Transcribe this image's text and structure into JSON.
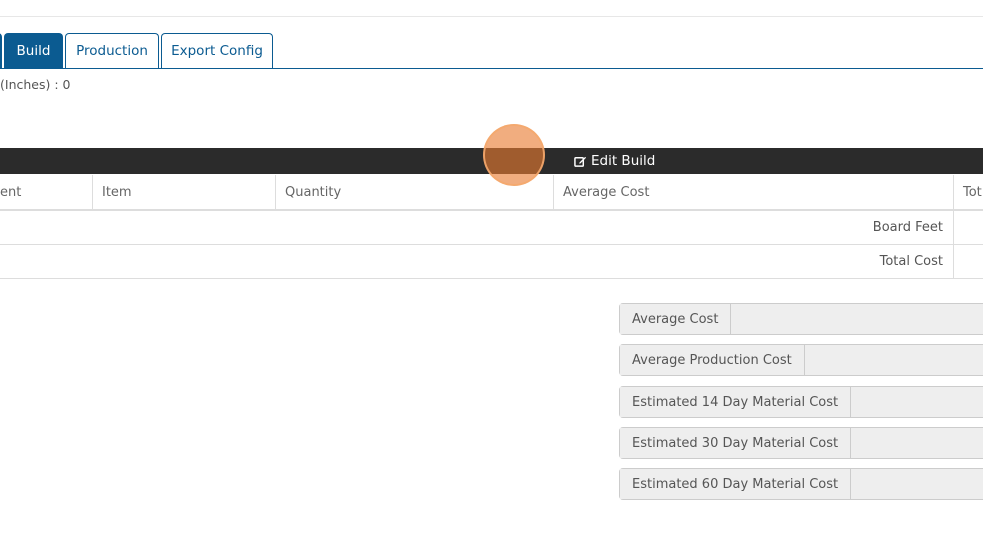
{
  "tabs": {
    "items": [
      {
        "label": "Build",
        "active": true
      },
      {
        "label": "Production",
        "active": false
      },
      {
        "label": "Export Config",
        "active": false
      }
    ]
  },
  "depth_text": "(Inches) : 0",
  "edit_bar": {
    "label": "Edit Build",
    "icon": "edit-icon"
  },
  "table": {
    "headers": [
      "ent",
      "Item",
      "Quantity",
      "Average Cost",
      "Tot"
    ],
    "summary_rows": [
      {
        "label": "Board Feet"
      },
      {
        "label": "Total Cost"
      }
    ]
  },
  "cost_summary": [
    {
      "label": "Average Cost"
    },
    {
      "label": "Average Production Cost"
    },
    {
      "label": "Estimated 14 Day Material Cost"
    },
    {
      "label": "Estimated 30 Day Material Cost"
    },
    {
      "label": "Estimated 60 Day Material Cost"
    }
  ],
  "colors": {
    "tab_active_bg": "#0b5b91",
    "bar_bg": "#2b2b2b",
    "highlight": "#e87a30"
  }
}
